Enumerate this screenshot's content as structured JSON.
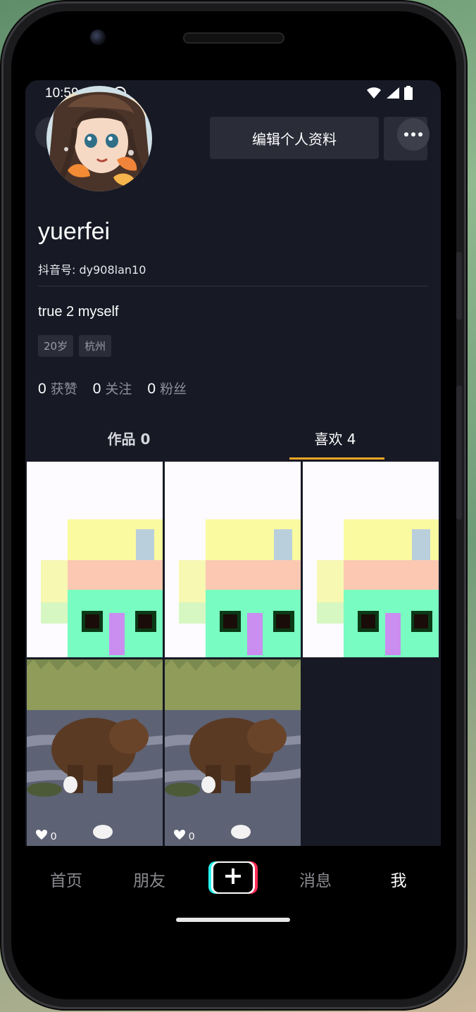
{
  "status_bar": {
    "time": "10:59"
  },
  "header": {
    "edit_profile_label": "编辑个人资料"
  },
  "profile": {
    "username": "yuerfei",
    "douyin_id": "抖音号: dy908lan10",
    "bio": "true 2 myself",
    "tags": [
      "20岁",
      "杭州"
    ],
    "stats": [
      {
        "value": "0",
        "label": "获赞"
      },
      {
        "value": "0",
        "label": "关注"
      },
      {
        "value": "0",
        "label": "粉丝"
      }
    ]
  },
  "tabs": [
    {
      "label": "作品 0",
      "active": false
    },
    {
      "label": "喜欢 4",
      "active": true
    }
  ],
  "grid": {
    "items": [
      {
        "kind": "house",
        "likes": ""
      },
      {
        "kind": "house",
        "likes": ""
      },
      {
        "kind": "house",
        "likes": ""
      },
      {
        "kind": "bear",
        "likes": "0"
      },
      {
        "kind": "bear",
        "likes": "0"
      }
    ]
  },
  "bottom_nav": [
    {
      "label": "首页",
      "active": false
    },
    {
      "label": "朋友",
      "active": false
    },
    {
      "label": "消息",
      "active": false
    },
    {
      "label": "我",
      "active": true
    }
  ],
  "colors": {
    "background": "#171925",
    "accent_underline": "#f5a623",
    "button_bg": "#2a2c38"
  },
  "icons": {
    "status_left": [
      "shield-off-icon",
      "android-icon"
    ],
    "status_right": [
      "wifi-icon",
      "signal-icon",
      "battery-icon"
    ],
    "header": [
      "back-icon",
      "chevron-down-icon",
      "more-icon"
    ],
    "nav_add": "plus-icon",
    "likes": "heart-icon"
  }
}
